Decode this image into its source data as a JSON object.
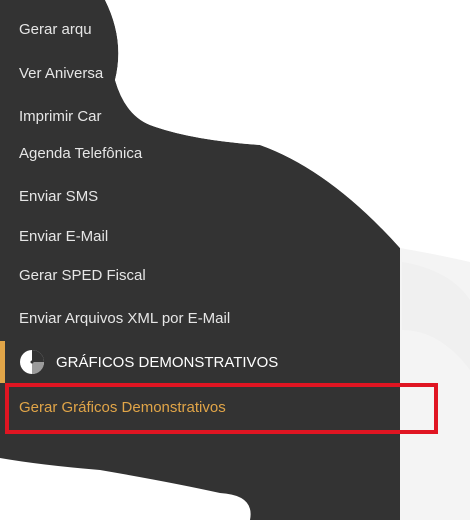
{
  "menu": {
    "items": [
      {
        "label": "Gerar arqu"
      },
      {
        "label": "Ver Aniversa"
      },
      {
        "label": "Imprimir Car"
      },
      {
        "label": "Agenda Telefônica"
      },
      {
        "label": "Enviar SMS"
      },
      {
        "label": "Enviar E-Mail"
      },
      {
        "label": "Gerar SPED Fiscal"
      },
      {
        "label": "Enviar Arquivos XML por E-Mail"
      }
    ],
    "section": {
      "label": "GRÁFICOS DEMONSTRATIVOS",
      "icon": "pie-chart-icon"
    },
    "active_item": {
      "label": "Gerar Gráficos Demonstrativos"
    }
  },
  "colors": {
    "background": "#333333",
    "text": "#e6e6e6",
    "accent": "#e1a548",
    "highlight_border": "#e01522"
  }
}
